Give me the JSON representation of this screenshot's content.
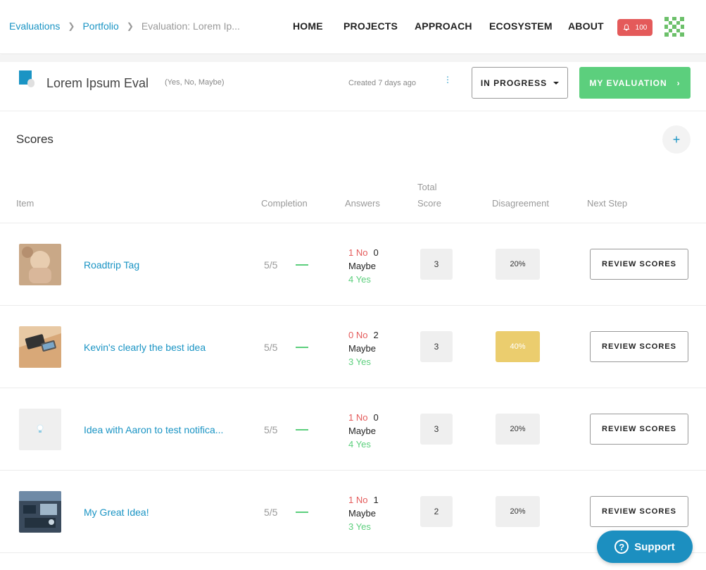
{
  "breadcrumb": {
    "items": [
      "Evaluations",
      "Portfolio"
    ],
    "current": "Evaluation: Lorem Ip..."
  },
  "nav": {
    "items": [
      "HOME",
      "PROJECTS",
      "APPROACH",
      "ECOSYSTEM",
      "ABOUT"
    ]
  },
  "notifications": {
    "count": "100",
    "color": "#e45a5a"
  },
  "evaluation": {
    "title": "Lorem Ipsum Eval",
    "scale": "(Yes, No, Maybe)",
    "created": "Created 7 days ago",
    "status": "IN PROGRESS",
    "my_evaluation": "MY EVALUATION"
  },
  "scores": {
    "title": "Scores",
    "add_icon": "plus-icon",
    "columns": {
      "item": "Item",
      "completion": "Completion",
      "answers": "Answers",
      "total_score_1": "Total",
      "total_score_2": "Score",
      "disagreement": "Disagreement",
      "next_step": "Next Step"
    },
    "rows": [
      {
        "name": "Roadtrip Tag",
        "completion": "5/5",
        "no": "1 No",
        "maybe_count": "0",
        "maybe": "Maybe",
        "yes": "4 Yes",
        "score": "3",
        "disagreement": "20%",
        "disagreement_level": 0.2,
        "action": "REVIEW SCORES"
      },
      {
        "name": "Kevin's clearly the best idea",
        "completion": "5/5",
        "no": "0 No",
        "maybe_count": "2",
        "maybe": "Maybe",
        "yes": "3 Yes",
        "score": "3",
        "disagreement": "40%",
        "disagreement_level": 0.4,
        "action": "REVIEW SCORES"
      },
      {
        "name": "Idea with Aaron to test notifica...",
        "completion": "5/5",
        "no": "1 No",
        "maybe_count": "0",
        "maybe": "Maybe",
        "yes": "4 Yes",
        "score": "3",
        "disagreement": "20%",
        "disagreement_level": 0.2,
        "action": "REVIEW SCORES"
      },
      {
        "name": "My Great Idea!",
        "completion": "5/5",
        "no": "1 No",
        "maybe_count": "1",
        "maybe": "Maybe",
        "yes": "3 Yes",
        "score": "2",
        "disagreement": "20%",
        "disagreement_level": 0.2,
        "action": "REVIEW SCORES"
      }
    ]
  },
  "support": {
    "label": "Support"
  },
  "colors": {
    "accent": "#1a94c4",
    "success": "#5ccf7d",
    "danger": "#e45a5a",
    "warning": "#ebcd6e"
  }
}
